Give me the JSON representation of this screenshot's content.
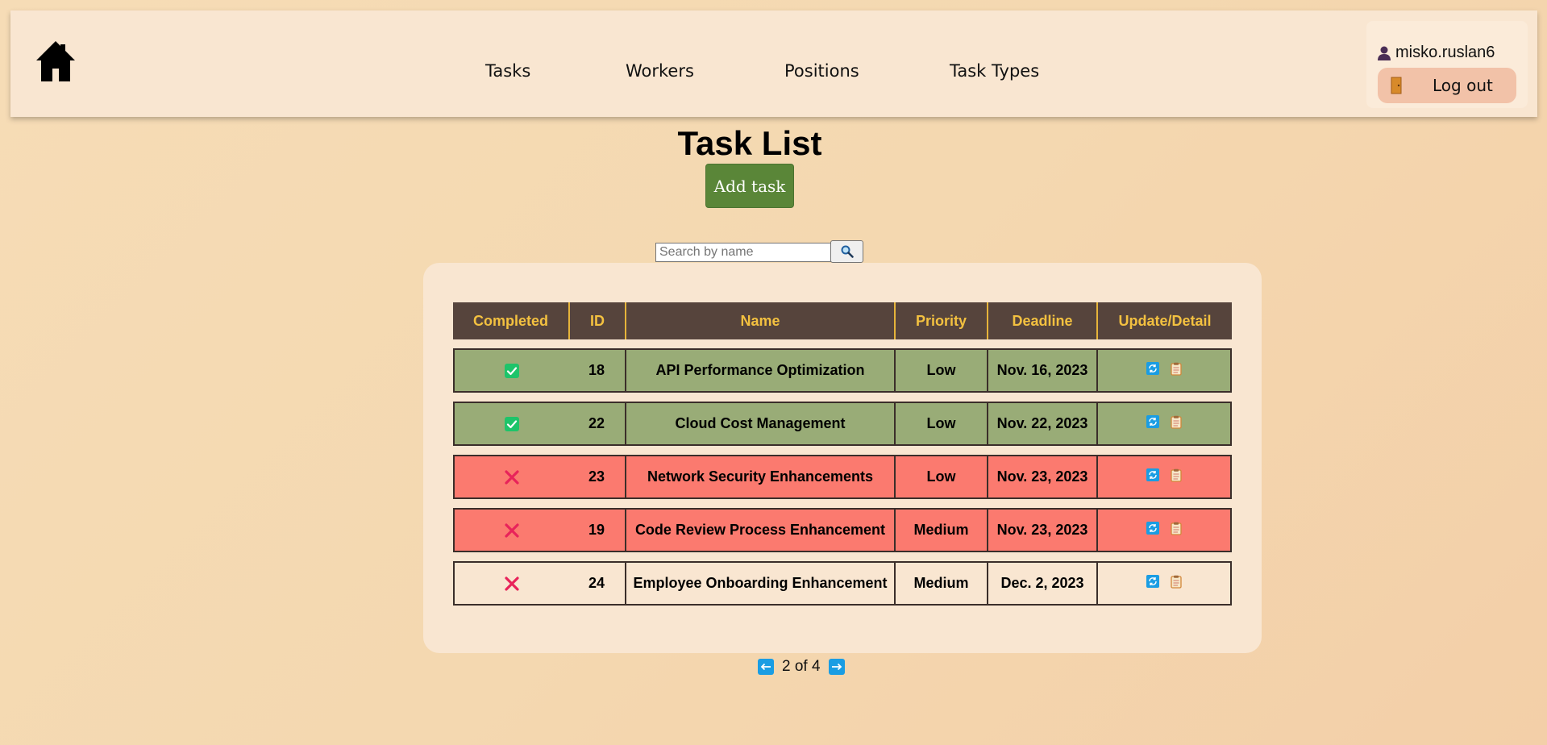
{
  "header": {
    "nav": [
      {
        "label": "Tasks"
      },
      {
        "label": "Workers"
      },
      {
        "label": "Positions"
      },
      {
        "label": "Task Types"
      }
    ],
    "username": "misko.ruslan6",
    "logout_label": "Log out"
  },
  "main": {
    "title": "Task List",
    "add_label": "Add task",
    "search_placeholder": "Search by name",
    "search_value": ""
  },
  "table": {
    "columns": [
      "Completed",
      "ID",
      "Name",
      "Priority",
      "Deadline",
      "Update/Detail"
    ],
    "rows": [
      {
        "completed": true,
        "id": "18",
        "name": "API Performance Optimization",
        "priority": "Low",
        "deadline": "Nov. 16, 2023",
        "status": "done"
      },
      {
        "completed": true,
        "id": "22",
        "name": "Cloud Cost Management",
        "priority": "Low",
        "deadline": "Nov. 22, 2023",
        "status": "done"
      },
      {
        "completed": false,
        "id": "23",
        "name": "Network Security Enhancements",
        "priority": "Low",
        "deadline": "Nov. 23, 2023",
        "status": "late"
      },
      {
        "completed": false,
        "id": "19",
        "name": "Code Review Process Enhancement",
        "priority": "Medium",
        "deadline": "Nov. 23, 2023",
        "status": "late"
      },
      {
        "completed": false,
        "id": "24",
        "name": "Employee Onboarding Enhancement",
        "priority": "Medium",
        "deadline": "Dec. 2, 2023",
        "status": "open"
      }
    ]
  },
  "pagination": {
    "text": "2 of 4"
  },
  "colors": {
    "header_bg": "#f9e6d1",
    "table_header_bg": "#56443c",
    "table_header_text": "#f3c140",
    "row_done": "#99ac77",
    "row_late": "#fb7a6f",
    "row_open": "#f9e6d1",
    "add_button": "#5a8638",
    "icon_blue": "#1a9de3"
  },
  "icons": {
    "home": "home-icon",
    "user": "user-icon",
    "logout": "door-icon",
    "search": "magnifier-icon",
    "completed": "checkbox-checked-icon",
    "not_completed": "cross-icon",
    "update": "refresh-icon",
    "detail": "clipboard-icon",
    "prev": "arrow-left-icon",
    "next": "arrow-right-icon"
  }
}
